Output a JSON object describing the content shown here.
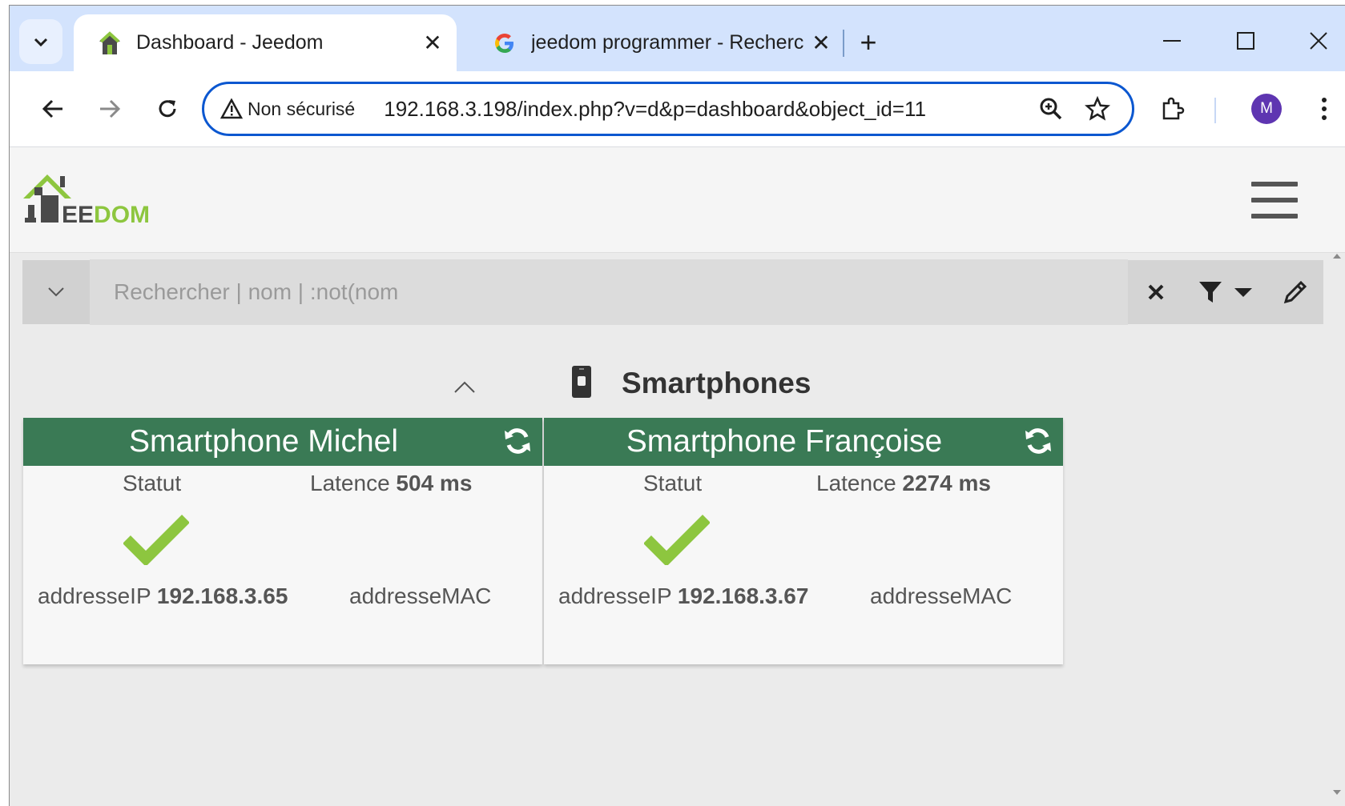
{
  "browser": {
    "tabs": [
      {
        "title": "Dashboard - Jeedom",
        "favicon": "jeedom-house-icon",
        "active": true
      },
      {
        "title": "jeedom programmer - Recherche",
        "favicon": "google-g-icon",
        "active": false
      }
    ],
    "security_label": "Non sécurisé",
    "url": "192.168.3.198/index.php?v=d&p=dashboard&object_id=11",
    "profile_initial": "M"
  },
  "app": {
    "logo_text_prefix": "EE",
    "logo_text_suffix": "DOM",
    "search_placeholder": "Rechercher | nom | :not(nom"
  },
  "object": {
    "title": "Smartphones",
    "icon": "smartphone-icon"
  },
  "cards": [
    {
      "name": "Smartphone Michel",
      "statut_label": "Statut",
      "latence_label": "Latence",
      "latence_value": "504 ms",
      "ip_label": "addresseIP",
      "ip_value": "192.168.3.65",
      "mac_label": "addresseMAC",
      "status": "ok"
    },
    {
      "name": "Smartphone Françoise",
      "statut_label": "Statut",
      "latence_label": "Latence",
      "latence_value": "2274 ms",
      "ip_label": "addresseIP",
      "ip_value": "192.168.3.67",
      "mac_label": "addresseMAC",
      "status": "ok"
    }
  ],
  "colors": {
    "card_header": "#3a7a55",
    "check": "#8dc63f",
    "omnibox_border": "#0b57d0",
    "tabstrip": "#d3e3fd"
  }
}
